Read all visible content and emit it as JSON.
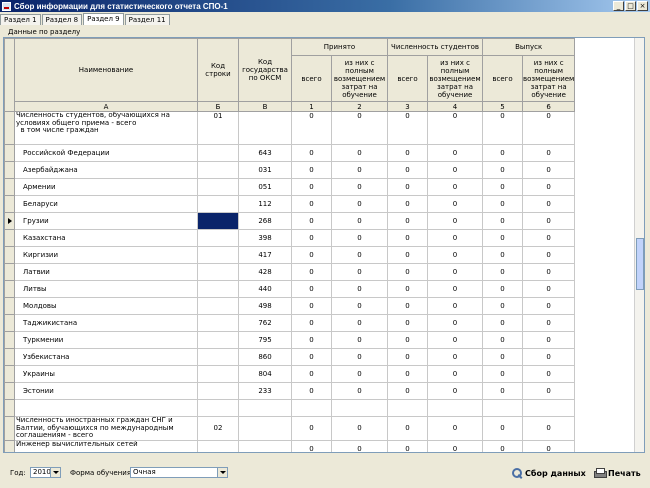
{
  "window": {
    "title": "Сбор информации для статистического отчета СПО-1",
    "minimize": "_",
    "maximize": "□",
    "close": "×"
  },
  "tabs": [
    {
      "label": "Раздел 1"
    },
    {
      "label": "Раздел 8"
    },
    {
      "label": "Раздел 9",
      "active": true
    },
    {
      "label": "Раздел 11"
    }
  ],
  "section_label": "Данные по разделу",
  "table": {
    "headers": {
      "name": "Наименование",
      "row_code": "Код строки",
      "country_code": "Код государства по ОКСМ",
      "accepted": "Принято",
      "students": "Численность студентов",
      "graduation": "Выпуск",
      "total": "всего",
      "full_cost": "из них с полным возмещением затрат на обучение"
    },
    "letters": [
      "А",
      "Б",
      "В",
      "1",
      "2",
      "3",
      "4",
      "5",
      "6"
    ],
    "rows": [
      {
        "name": "Численность студентов, обучающихся на условиях общего приема - всего\n  в том числе граждан",
        "code": "01",
        "country": "",
        "values": [
          "0",
          "0",
          "0",
          "0",
          "0",
          "0"
        ],
        "tall": true,
        "multi": true
      },
      {
        "name": "Российской Федерации",
        "code": "",
        "country": "643",
        "values": [
          "0",
          "0",
          "0",
          "0",
          "0",
          "0"
        ]
      },
      {
        "name": "Азербайджана",
        "code": "",
        "country": "031",
        "values": [
          "0",
          "0",
          "0",
          "0",
          "0",
          "0"
        ]
      },
      {
        "name": "Армении",
        "code": "",
        "country": "051",
        "values": [
          "0",
          "0",
          "0",
          "0",
          "0",
          "0"
        ]
      },
      {
        "name": "Беларуси",
        "code": "",
        "country": "112",
        "values": [
          "0",
          "0",
          "0",
          "0",
          "0",
          "0"
        ]
      },
      {
        "name": "Грузии",
        "code": "",
        "country": "268",
        "values": [
          "0",
          "0",
          "0",
          "0",
          "0",
          "0"
        ],
        "current": true
      },
      {
        "name": "Казахстана",
        "code": "",
        "country": "398",
        "values": [
          "0",
          "0",
          "0",
          "0",
          "0",
          "0"
        ]
      },
      {
        "name": "Киргизии",
        "code": "",
        "country": "417",
        "values": [
          "0",
          "0",
          "0",
          "0",
          "0",
          "0"
        ]
      },
      {
        "name": "Латвии",
        "code": "",
        "country": "428",
        "values": [
          "0",
          "0",
          "0",
          "0",
          "0",
          "0"
        ]
      },
      {
        "name": "Литвы",
        "code": "",
        "country": "440",
        "values": [
          "0",
          "0",
          "0",
          "0",
          "0",
          "0"
        ]
      },
      {
        "name": "Молдовы",
        "code": "",
        "country": "498",
        "values": [
          "0",
          "0",
          "0",
          "0",
          "0",
          "0"
        ]
      },
      {
        "name": "Таджикистана",
        "code": "",
        "country": "762",
        "values": [
          "0",
          "0",
          "0",
          "0",
          "0",
          "0"
        ]
      },
      {
        "name": "Туркмении",
        "code": "",
        "country": "795",
        "values": [
          "0",
          "0",
          "0",
          "0",
          "0",
          "0"
        ]
      },
      {
        "name": "Узбекистана",
        "code": "",
        "country": "860",
        "values": [
          "0",
          "0",
          "0",
          "0",
          "0",
          "0"
        ]
      },
      {
        "name": "Украины",
        "code": "",
        "country": "804",
        "values": [
          "0",
          "0",
          "0",
          "0",
          "0",
          "0"
        ]
      },
      {
        "name": "Эстонии",
        "code": "",
        "country": "233",
        "values": [
          "0",
          "0",
          "0",
          "0",
          "0",
          "0"
        ]
      },
      {
        "name": "",
        "code": "",
        "country": "",
        "values": [
          "",
          "",
          "",
          "",
          "",
          ""
        ]
      },
      {
        "name": "Численность иностранных граждан СНГ и Балтии, обучающихся по международным соглашениям - всего",
        "code": "02",
        "country": "",
        "values": [
          "0",
          "0",
          "0",
          "0",
          "0",
          "0"
        ],
        "multi": true
      },
      {
        "name": "Инженер вычислительных сетей",
        "code": "",
        "country": "",
        "values": [
          "0",
          "0",
          "0",
          "0",
          "0",
          "0"
        ],
        "multi": true
      }
    ]
  },
  "bottom": {
    "year_label": "Год:",
    "year_value": "2010",
    "form_label": "Форма обучения:",
    "form_value": "Очная",
    "gather_button": "Сбор данных",
    "print_button": "Печать"
  }
}
